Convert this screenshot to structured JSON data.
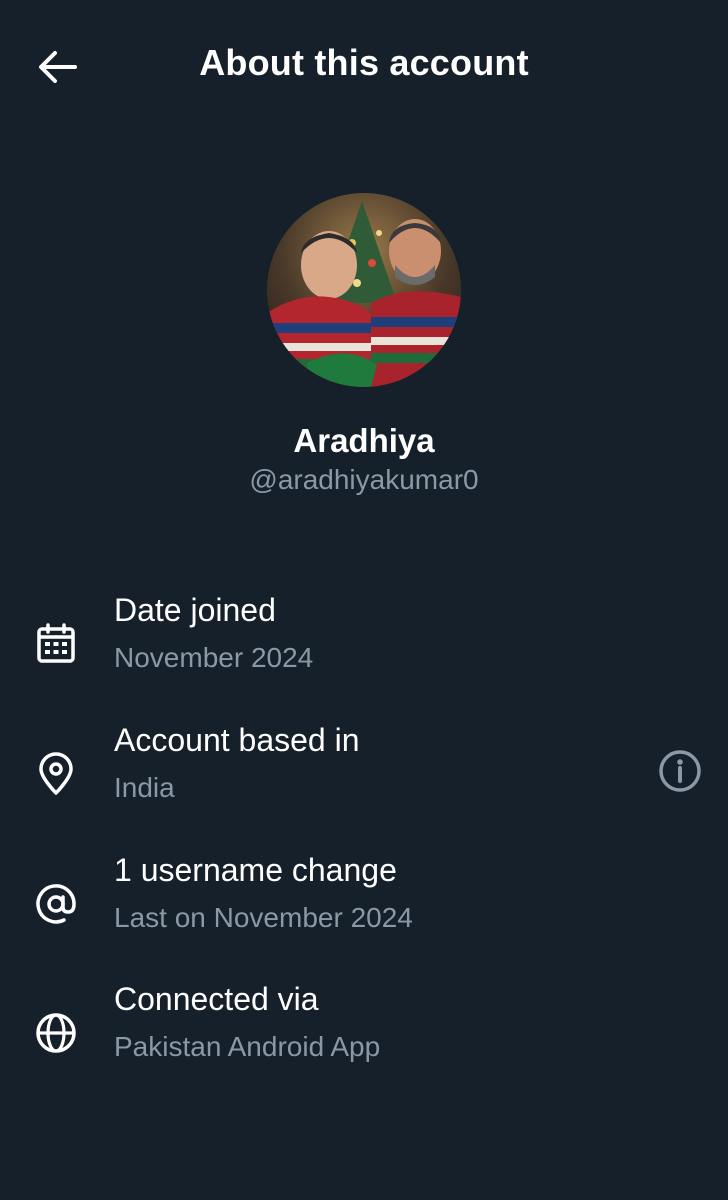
{
  "header": {
    "title": "About this account",
    "back_icon": "arrow-left-icon"
  },
  "profile": {
    "name": "Aradhiya",
    "handle": "@aradhiyakumar0"
  },
  "details": [
    {
      "icon": "calendar-icon",
      "title": "Date joined",
      "subtitle": "November 2024"
    },
    {
      "icon": "location-pin-icon",
      "title": "Account based in",
      "subtitle": "India",
      "action_icon": "info-icon"
    },
    {
      "icon": "at-sign-icon",
      "title": "1 username change",
      "subtitle": "Last on November 2024"
    },
    {
      "icon": "globe-icon",
      "title": "Connected via",
      "subtitle": "Pakistan Android App"
    }
  ],
  "colors": {
    "background": "#16202a",
    "primary_text": "#ffffff",
    "secondary_text": "#8b98a5"
  }
}
